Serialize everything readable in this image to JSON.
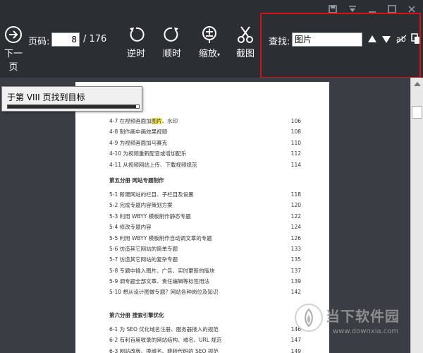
{
  "toolbar": {
    "next_label": "下一页",
    "page_label": "页码:",
    "page_value": "8",
    "page_total": "/ 176",
    "rotate_ccw_label": "逆时",
    "rotate_cw_label": "顺时",
    "zoom_label": "缩放",
    "screenshot_label": "截图",
    "find_label": "查找:",
    "find_value": "图片"
  },
  "popup": {
    "text": "于第 VIII 页找到目标",
    "progress": 0.98
  },
  "toc": {
    "rows_a": [
      {
        "pre": "4-7 在视频画面加",
        "hl": "图片",
        "post": "、水印",
        "num": "106"
      },
      {
        "pre": "4-8 制作画中画效果视频",
        "hl": "",
        "post": "",
        "num": "108"
      },
      {
        "pre": "4-9 为视频画面加马赛克",
        "hl": "",
        "post": "",
        "num": "110"
      },
      {
        "pre": "4-10 为视频重新配音或增加配乐",
        "hl": "",
        "post": "",
        "num": "112"
      },
      {
        "pre": "4-11 从视频网站上传、下载视频规范",
        "hl": "",
        "post": "",
        "num": "114"
      }
    ],
    "section5": "第五分册  网站专题制作",
    "rows_b": [
      {
        "title": "5-1 新建网站的栏目、子栏目及设置",
        "num": "118"
      },
      {
        "title": "5-2 完成专题内容策划方案",
        "num": "120"
      },
      {
        "title": "5-3 利用 WBYY 模板制作静态专题",
        "num": "122"
      },
      {
        "title": "5-4 修改专题内容",
        "num": "124"
      },
      {
        "title": "5-5 利用 WBYY 模板制作自动调文章的专题",
        "num": "126"
      },
      {
        "title": "5-6 仿造其它网站的简单专题",
        "num": "133"
      },
      {
        "title": "5-7 仿造其它网站的复杂专题",
        "num": "135"
      },
      {
        "title": "5-8 专题中插入图片、广告、实时更新的版块",
        "num": "137"
      },
      {
        "title": "5-9 调专题全部文章、责任编辑等标签用法",
        "num": "139"
      },
      {
        "title": "5-10 想从设计图做专题？网站各种岗位及知识",
        "num": "142"
      }
    ],
    "section6": "第六分册  搜索引擎优化",
    "rows_c": [
      {
        "title": "6-1 为 SEO 优化域名注册、服务器接入的规范",
        "num": "146"
      },
      {
        "title": "6-2 有利百度收录的网站结构、域名、URL 规范",
        "num": "147"
      },
      {
        "title": "6-3 网站改版、换域名、跳转代码的 SEO 规范",
        "num": "149"
      }
    ]
  },
  "watermark": {
    "name": "当下软件园",
    "url": "www.downxia.com"
  },
  "colors": {
    "toolbar_bg": "#2b2e33",
    "search_outline": "#d4121a",
    "highlight": "#f7ec57"
  },
  "icons": [
    "next-page-icon",
    "rotate-ccw-icon",
    "rotate-cw-icon",
    "zoom-icon",
    "scissors-icon",
    "match-case-icon",
    "copy-icon"
  ]
}
